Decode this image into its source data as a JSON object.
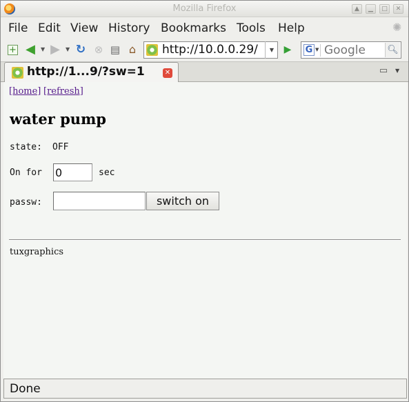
{
  "window": {
    "title": "Mozilla Firefox",
    "app_icon": "firefox-logo-icon",
    "controls": [
      "window-up-icon",
      "minimize-icon",
      "maximize-icon",
      "close-icon"
    ]
  },
  "menubar": {
    "items": [
      "File",
      "Edit",
      "View",
      "History",
      "Bookmarks",
      "Tools",
      "Help"
    ]
  },
  "navbar": {
    "icons": [
      "new-tab-icon",
      "back-arrow-icon",
      "forward-arrow-icon",
      "reload-icon",
      "stop-icon",
      "print-icon",
      "home-icon"
    ],
    "url": "http://10.0.0.29/",
    "go_icon": "go-arrow-icon",
    "search_engine_icon": "google-icon",
    "search_placeholder": "Google",
    "search_icon": "magnifier-icon"
  },
  "tabs": [
    {
      "title": "http://1...9/?sw=1",
      "favicon": "page-favicon-icon"
    }
  ],
  "page": {
    "links": [
      "[home]",
      "[refresh]"
    ],
    "heading": "water pump",
    "state_label": "state:",
    "state_value": "OFF",
    "on_for_label": "On for",
    "on_for_value": "0",
    "sec_label": "sec",
    "passw_label": "passw:",
    "password_value": "",
    "switch_button": "switch on",
    "footer": "tuxgraphics"
  },
  "status": {
    "text": "Done"
  },
  "colors": {
    "link": "#551a8b",
    "go_green": "#35a035",
    "tab_close": "#e04a3b",
    "content_bg": "#f4f6f3"
  }
}
